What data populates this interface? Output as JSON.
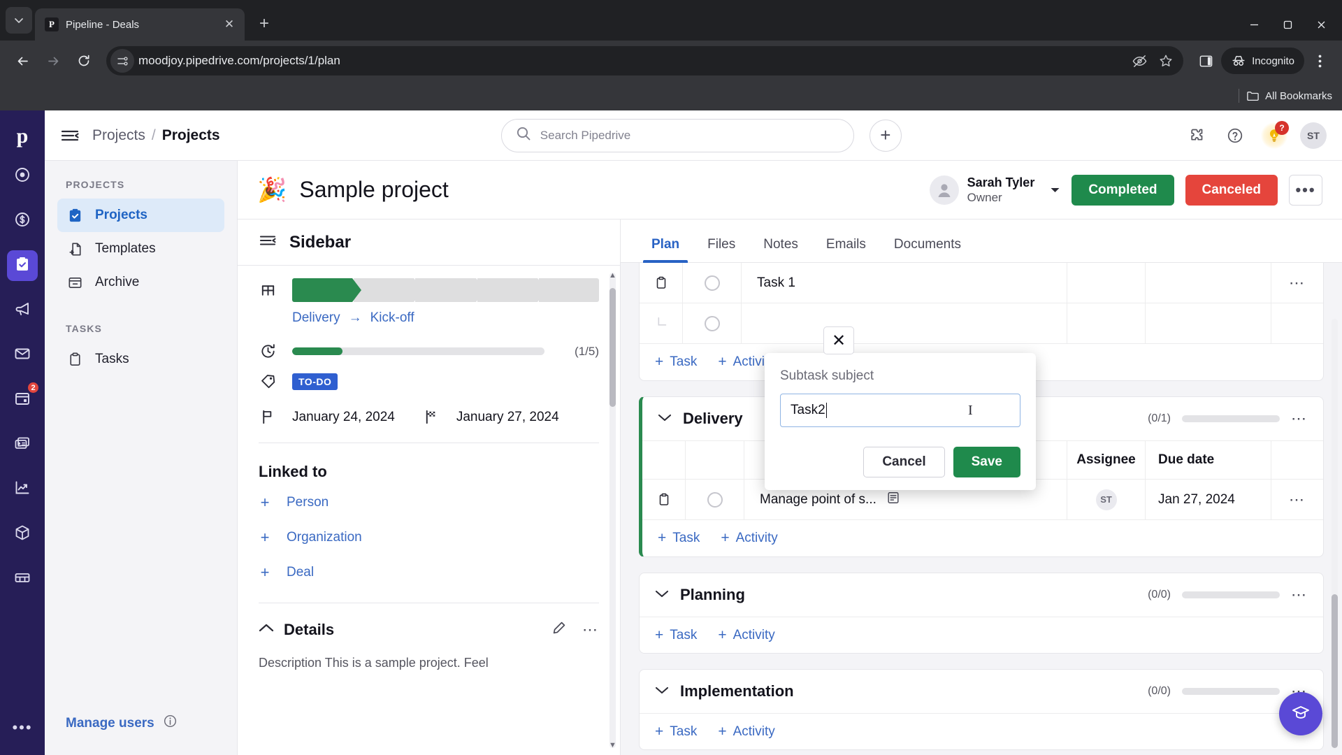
{
  "browser": {
    "tab": {
      "title": "Pipeline - Deals",
      "favicon_letter": "P",
      "close_label": "✕"
    },
    "new_tab_label": "+",
    "window": {
      "minimize": "—",
      "maximize": "❐",
      "close": "✕"
    },
    "url": "moodjoy.pipedrive.com/projects/1/plan",
    "incognito_label": "Incognito",
    "bookmarks_label": "All Bookmarks"
  },
  "rail": {
    "logo": "p",
    "items": [
      {
        "name": "leads-icon",
        "badge": ""
      },
      {
        "name": "deals-icon",
        "badge": ""
      },
      {
        "name": "projects-icon",
        "badge": "",
        "active": true
      },
      {
        "name": "campaigns-icon",
        "badge": ""
      },
      {
        "name": "mail-icon",
        "badge": ""
      },
      {
        "name": "activities-calendar-icon",
        "badge": "2"
      },
      {
        "name": "contacts-icon",
        "badge": ""
      },
      {
        "name": "insights-icon",
        "badge": ""
      },
      {
        "name": "products-icon",
        "badge": ""
      },
      {
        "name": "marketplace-icon",
        "badge": ""
      }
    ],
    "more_label": "•••"
  },
  "topbar": {
    "breadcrumb": {
      "parent": "Projects",
      "separator": "/",
      "current": "Projects"
    },
    "search": {
      "placeholder": "Search Pipedrive"
    },
    "add_label": "+",
    "notification_badge": "?",
    "avatar_initials": "ST"
  },
  "nav": {
    "sections": [
      {
        "heading": "PROJECTS",
        "items": [
          {
            "label": "Projects",
            "icon": "projects-board-icon",
            "active": true
          },
          {
            "label": "Templates",
            "icon": "template-icon",
            "active": false
          },
          {
            "label": "Archive",
            "icon": "archive-icon",
            "active": false
          }
        ]
      },
      {
        "heading": "TASKS",
        "items": [
          {
            "label": "Tasks",
            "icon": "tasks-clipboard-icon",
            "active": false
          }
        ]
      }
    ],
    "manage_users": "Manage users"
  },
  "project": {
    "emoji": "🎉",
    "title": "Sample project",
    "owner": {
      "name": "Sarah Tyler",
      "role": "Owner"
    },
    "buttons": {
      "completed": "Completed",
      "canceled": "Canceled",
      "more": "•••"
    }
  },
  "sidebar": {
    "title": "Sidebar",
    "phases": {
      "total": 5,
      "completed": 1,
      "from": "Delivery",
      "arrow": "→",
      "to": "Kick-off"
    },
    "progress": {
      "label": "(1/5)",
      "done": 1,
      "total": 5,
      "percent": 20
    },
    "tag": "TO-DO",
    "start_date": "January 24, 2024",
    "end_date": "January 27, 2024",
    "linked_to": {
      "heading": "Linked to",
      "items": [
        {
          "label": "Person",
          "plus": "+"
        },
        {
          "label": "Organization",
          "plus": "+"
        },
        {
          "label": "Deal",
          "plus": "+"
        }
      ]
    },
    "details": {
      "heading": "Details",
      "preview": "Description   This is a sample project. Feel"
    }
  },
  "plan": {
    "tabs": [
      {
        "label": "Plan",
        "active": true
      },
      {
        "label": "Files",
        "active": false
      },
      {
        "label": "Notes",
        "active": false
      },
      {
        "label": "Emails",
        "active": false
      },
      {
        "label": "Documents",
        "active": false
      }
    ],
    "columns": {
      "assignee": "Assignee",
      "due_date": "Due date"
    },
    "add_task": "Task",
    "add_activity": "Activity",
    "add_plus": "+",
    "groups": [
      {
        "name": "",
        "count": "",
        "progress_percent": 0,
        "rows": [
          {
            "subject": "Task 1",
            "assignee": "",
            "due_date": "",
            "has_note": false
          },
          {
            "subject": "",
            "assignee": "",
            "due_date": "",
            "has_note": false
          }
        ]
      },
      {
        "name": "Delivery",
        "count": "(0/1)",
        "progress_percent": 5,
        "rows": [
          {
            "subject": "Manage point of s...",
            "assignee": "ST",
            "due_date": "Jan 27, 2024",
            "has_note": true
          }
        ]
      },
      {
        "name": "Planning",
        "count": "(0/0)",
        "progress_percent": 3,
        "rows": []
      },
      {
        "name": "Implementation",
        "count": "(0/0)",
        "progress_percent": 3,
        "rows": []
      }
    ]
  },
  "popover": {
    "label": "Subtask subject",
    "input_value": "Task2",
    "cancel": "Cancel",
    "save": "Save",
    "close": "✕"
  },
  "colors": {
    "brand_purple": "#5a49d6",
    "rail_bg": "#261e57",
    "green": "#1f8a4c",
    "red": "#e5453c",
    "link_blue": "#3a69c2",
    "tag_blue": "#2f5fd0"
  }
}
